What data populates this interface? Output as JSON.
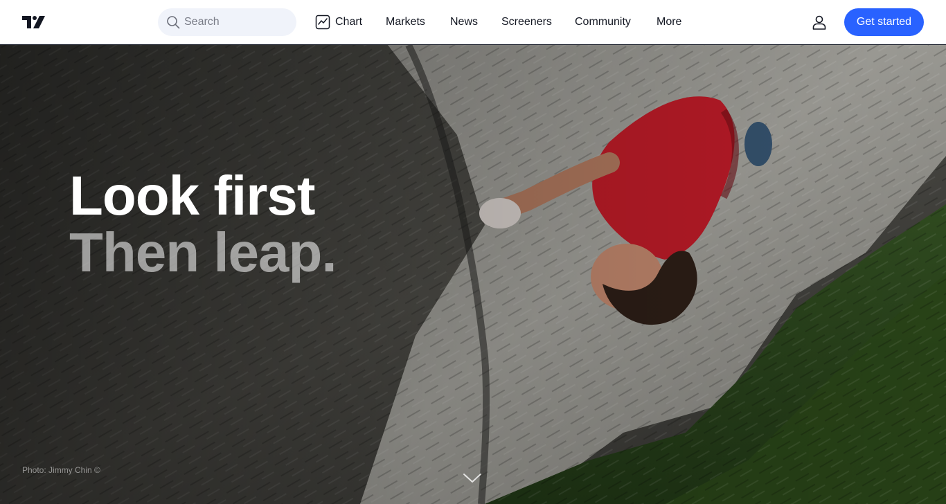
{
  "header": {
    "search_placeholder": "Search",
    "nav": {
      "chart": "Chart",
      "markets": "Markets",
      "news": "News",
      "screeners": "Screeners",
      "community": "Community",
      "more": "More"
    },
    "cta_label": "Get started",
    "icons": {
      "logo": "tradingview-logo-icon",
      "search": "search-icon",
      "chart": "chart-icon",
      "user": "user-icon"
    }
  },
  "hero": {
    "headline_line1": "Look first",
    "headline_line2": "Then leap.",
    "photo_credit": "Photo: Jimmy Chin ©",
    "scroll_icon": "chevron-down-icon"
  },
  "colors": {
    "accent": "#2962ff",
    "header_bg": "#ffffff",
    "search_bg": "#f0f3fa",
    "text": "#131722",
    "placeholder": "#787b86"
  }
}
